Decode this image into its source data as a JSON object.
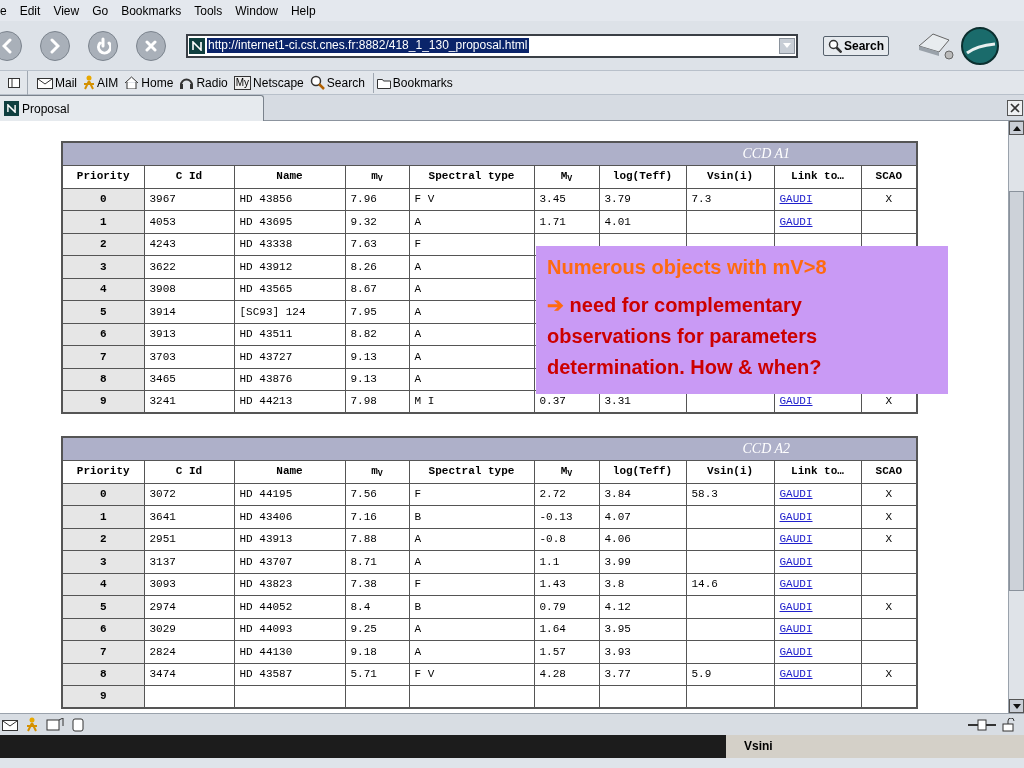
{
  "menu_bar": [
    "e",
    "Edit",
    "View",
    "Go",
    "Bookmarks",
    "Tools",
    "Window",
    "Help"
  ],
  "address_bar": {
    "url": "http://internet1-ci.cst.cnes.fr:8882/418_1_130_proposal.html"
  },
  "search_button": "Search",
  "personal_toolbar": [
    {
      "label": "Mail",
      "kind": "mail"
    },
    {
      "label": "AIM",
      "kind": "aim"
    },
    {
      "label": "Home",
      "kind": "home"
    },
    {
      "label": "Radio",
      "kind": "radio"
    },
    {
      "label": "Netscape",
      "kind": "my",
      "badge": "My"
    },
    {
      "label": "Search",
      "kind": "search"
    },
    {
      "label": "Bookmarks",
      "kind": "folder"
    }
  ],
  "tab": {
    "title": "Proposal"
  },
  "tables": [
    {
      "title": "CCD A1",
      "columns": [
        {
          "label": "Priority",
          "kind": "index"
        },
        {
          "label": "C Id",
          "kind": "text"
        },
        {
          "label": "Name",
          "kind": "text"
        },
        {
          "label": "m$_{V}$",
          "kind": "text"
        },
        {
          "label": "Spectral type",
          "kind": "text"
        },
        {
          "label": "M$_{V}$",
          "kind": "text"
        },
        {
          "label": "log(Teff)",
          "kind": "text"
        },
        {
          "label": "Vsin(i)",
          "kind": "text"
        },
        {
          "label": "Link to…",
          "kind": "link"
        },
        {
          "label": "SCAO",
          "kind": "mark"
        }
      ],
      "rows": [
        [
          "0",
          "3967",
          "HD 43856",
          "7.96",
          "F V",
          "3.45",
          "3.79",
          "7.3",
          "GAUDI",
          "X"
        ],
        [
          "1",
          "4053",
          "HD 43695",
          "9.32",
          "A",
          "1.71",
          "4.01",
          null,
          "GAUDI",
          null
        ],
        [
          "2",
          "4243",
          "HD 43338",
          "7.63",
          "F"
        ],
        [
          "3",
          "3622",
          "HD 43912",
          "8.26",
          "A"
        ],
        [
          "4",
          "3908",
          "HD 43565",
          "8.67",
          "A"
        ],
        [
          "5",
          "3914",
          "[SC93] 124",
          "7.95",
          "A"
        ],
        [
          "6",
          "3913",
          "HD 43511",
          "8.82",
          "A"
        ],
        [
          "7",
          "3703",
          "HD 43727",
          "9.13",
          "A"
        ],
        [
          "8",
          "3465",
          "HD 43876",
          "9.13",
          "A"
        ],
        [
          "9",
          "3241",
          "HD 44213",
          "7.98",
          "M I",
          "0.37",
          "3.31",
          null,
          "GAUDI",
          "X"
        ]
      ]
    },
    {
      "title": "CCD A2",
      "columns": [
        {
          "label": "Priority",
          "kind": "index"
        },
        {
          "label": "C Id",
          "kind": "text"
        },
        {
          "label": "Name",
          "kind": "text"
        },
        {
          "label": "m$_{V}$",
          "kind": "text"
        },
        {
          "label": "Spectral type",
          "kind": "text"
        },
        {
          "label": "M$_{V}$",
          "kind": "text"
        },
        {
          "label": "log(Teff)",
          "kind": "text"
        },
        {
          "label": "Vsin(i)",
          "kind": "text"
        },
        {
          "label": "Link to…",
          "kind": "link"
        },
        {
          "label": "SCAO",
          "kind": "mark"
        }
      ],
      "rows": [
        [
          "0",
          "3072",
          "HD 44195",
          "7.56",
          "F",
          "2.72",
          "3.84",
          "58.3",
          "GAUDI",
          "X"
        ],
        [
          "1",
          "3641",
          "HD 43406",
          "7.16",
          "B",
          "-0.13",
          "4.07",
          null,
          "GAUDI",
          "X"
        ],
        [
          "2",
          "2951",
          "HD 43913",
          "7.88",
          "A",
          "-0.8",
          "4.06",
          null,
          "GAUDI",
          "X"
        ],
        [
          "3",
          "3137",
          "HD 43707",
          "8.71",
          "A",
          "1.1",
          "3.99",
          null,
          "GAUDI",
          null
        ],
        [
          "4",
          "3093",
          "HD 43823",
          "7.38",
          "F",
          "1.43",
          "3.8",
          "14.6",
          "GAUDI",
          null
        ],
        [
          "5",
          "2974",
          "HD 44052",
          "8.4",
          "B",
          "0.79",
          "4.12",
          null,
          "GAUDI",
          "X"
        ],
        [
          "6",
          "3029",
          "HD 44093",
          "9.25",
          "A",
          "1.64",
          "3.95",
          null,
          "GAUDI",
          null
        ],
        [
          "7",
          "2824",
          "HD 44130",
          "9.18",
          "A",
          "1.57",
          "3.93",
          null,
          "GAUDI",
          null
        ],
        [
          "8",
          "3474",
          "HD 43587",
          "5.71",
          "F V",
          "4.28",
          "3.77",
          "5.9",
          "GAUDI",
          "X"
        ],
        [
          "9"
        ]
      ]
    }
  ],
  "overlay_note": {
    "heading": "Numerous objects with mV>8",
    "arrow": "➔",
    "body": "need for complementary observations for parameters determination. How & when?"
  },
  "taskbar": {
    "label": "Vsini"
  }
}
